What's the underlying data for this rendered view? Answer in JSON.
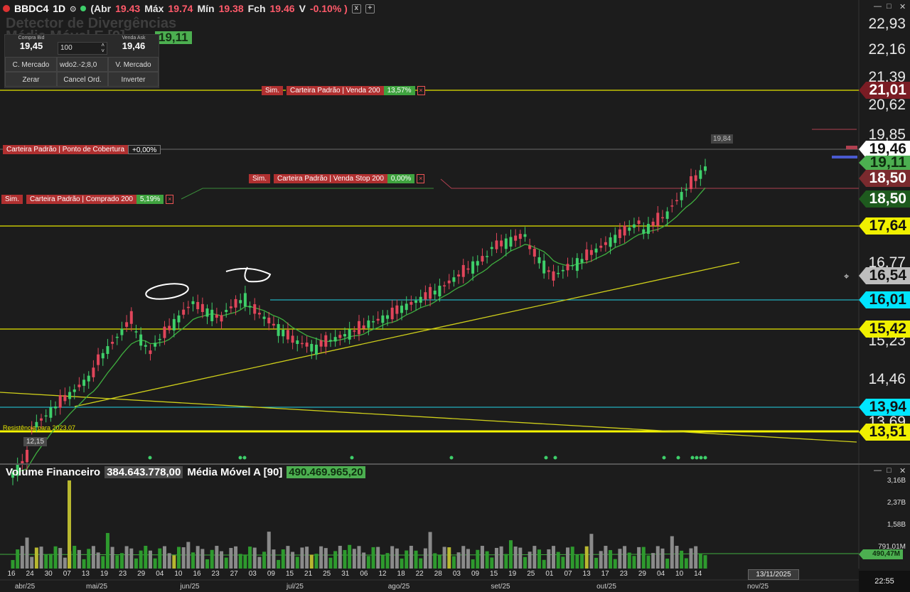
{
  "header": {
    "symbol": "BBDC4",
    "timeframe": "1D",
    "abr_label": "(Abr",
    "abr_value": "19.43",
    "max_label": "Máx",
    "max_value": "19.74",
    "min_label": "Mín",
    "min_value": "19.38",
    "fch_label": "Fch",
    "fch_value": "19.46",
    "var_label": "V",
    "var_value": "-0.10% )",
    "close_btn": "x",
    "add_btn": "+"
  },
  "ghost": {
    "indicator_title": "Detector de Divergências",
    "mm_label": "Média Móvel E [9]",
    "mm_value": "19,11"
  },
  "order_panel": {
    "bid_label": "Compra Bid",
    "bid_value": "19,45",
    "qty_value": "100",
    "ask_label": "Venda Ask",
    "ask_value": "19,46",
    "buy_market": "C. Mercado",
    "strategy": "wdo2.-2;8,0",
    "sell_market": "V. Mercado",
    "zero": "Zerar",
    "cancel": "Cancel Ord.",
    "invert": "Inverter"
  },
  "orders": {
    "sell200": {
      "sim": "Sim.",
      "name": "Carteira Padrão | Venda 200",
      "pct": "13,57%",
      "x": "×"
    },
    "coverage": {
      "name": "Carteira Padrão | Ponto de Cobertura",
      "pct": "+0,00%"
    },
    "sellstop": {
      "sim": "Sim.",
      "name": "Carteira Padrão | Venda Stop 200",
      "pct": "0,00%",
      "x": "×"
    },
    "bought": {
      "sim": "Sim.",
      "name": "Carteira Padrão | Comprado 200",
      "pct": "5,19%",
      "x": "×"
    }
  },
  "price_axis": {
    "labels": [
      "22,93",
      "22,16",
      "21,39",
      "20,62",
      "19,85",
      "16,77",
      "15,23",
      "14,46",
      "13,69"
    ],
    "badges": [
      {
        "value": "21,01",
        "bg": "#7a1c24",
        "fg": "#ffffff"
      },
      {
        "value": "19,46",
        "bg": "#ffffff",
        "fg": "#111111"
      },
      {
        "value": "19,11",
        "bg": "#4caf50",
        "fg": "#0f2f0f"
      },
      {
        "value": "18,50",
        "bg": "#7a2a2e",
        "fg": "#ffffff"
      },
      {
        "value": "18,50",
        "bg": "#1e5a1e",
        "fg": "#ffffff"
      },
      {
        "value": "17,64",
        "bg": "#f0f000",
        "fg": "#111111"
      },
      {
        "value": "16,54",
        "bg": "#bdbdbd",
        "fg": "#111111"
      },
      {
        "value": "16,01",
        "bg": "#00e5ff",
        "fg": "#111111"
      },
      {
        "value": "15,42",
        "bg": "#f0f000",
        "fg": "#111111"
      },
      {
        "value": "13,94",
        "bg": "#00e5ff",
        "fg": "#111111"
      },
      {
        "value": "13,51",
        "bg": "#f0f000",
        "fg": "#111111"
      }
    ]
  },
  "annotations": {
    "resistance": "Resistência para 2023.07",
    "low_label": "12,15",
    "high_label": "19,84"
  },
  "volume": {
    "title": "Volume Financeiro",
    "value": "384.643.778,00",
    "ma_label": "Média Móvel A [90]",
    "ma_value": "490.469.965,20",
    "axis": [
      "3,16B",
      "2,37B",
      "1,58B",
      "791,01M"
    ],
    "badge": "490,47M"
  },
  "window_controls": {
    "minimize": "—",
    "maximize": "□",
    "close": "✕"
  },
  "dates": [
    "16",
    "24",
    "30",
    "07",
    "13",
    "19",
    "23",
    "29",
    "04",
    "10",
    "16",
    "23",
    "27",
    "03",
    "09",
    "15",
    "21",
    "25",
    "31",
    "06",
    "12",
    "18",
    "22",
    "28",
    "03",
    "09",
    "15",
    "19",
    "25",
    "01",
    "07",
    "13",
    "17",
    "23",
    "29",
    "04",
    "10",
    "14"
  ],
  "months": [
    "abr/25",
    "mai/25",
    "jun/25",
    "jul/25",
    "ago/25",
    "set/25",
    "out/25",
    "nov/25"
  ],
  "cursor_date": "13/11/2025",
  "clock": "22:55",
  "colors": {
    "up": "#3ecf6a",
    "down": "#e0455a",
    "ma": "#3fae3f",
    "yellow": "#e6e600",
    "cyan": "#22d3e6"
  }
}
